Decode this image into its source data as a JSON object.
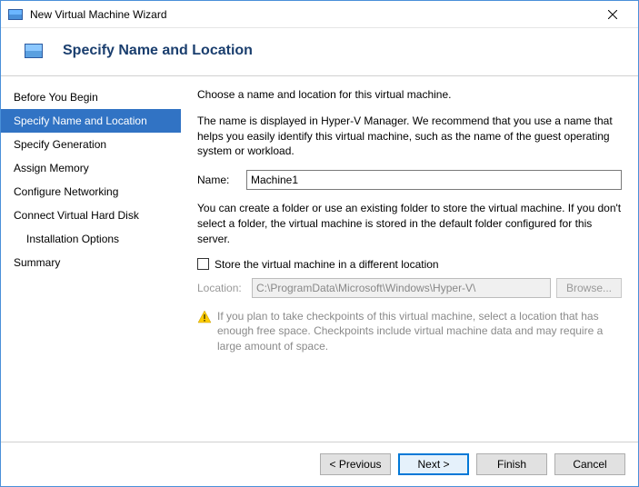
{
  "titlebar": {
    "title": "New Virtual Machine Wizard"
  },
  "header": {
    "title": "Specify Name and Location"
  },
  "sidebar": {
    "items": [
      {
        "label": "Before You Begin"
      },
      {
        "label": "Specify Name and Location"
      },
      {
        "label": "Specify Generation"
      },
      {
        "label": "Assign Memory"
      },
      {
        "label": "Configure Networking"
      },
      {
        "label": "Connect Virtual Hard Disk"
      },
      {
        "label": "Installation Options"
      },
      {
        "label": "Summary"
      }
    ]
  },
  "content": {
    "intro": "Choose a name and location for this virtual machine.",
    "name_help": "The name is displayed in Hyper-V Manager. We recommend that you use a name that helps you easily identify this virtual machine, such as the name of the guest operating system or workload.",
    "name_label": "Name:",
    "name_value": "Machine1",
    "folder_help": "You can create a folder or use an existing folder to store the virtual machine. If you don't select a folder, the virtual machine is stored in the default folder configured for this server.",
    "store_checkbox": "Store the virtual machine in a different location",
    "location_label": "Location:",
    "location_value": "C:\\ProgramData\\Microsoft\\Windows\\Hyper-V\\",
    "browse_label": "Browse...",
    "warning": "If you plan to take checkpoints of this virtual machine, select a location that has enough free space. Checkpoints include virtual machine data and may require a large amount of space."
  },
  "footer": {
    "previous": "< Previous",
    "next": "Next >",
    "finish": "Finish",
    "cancel": "Cancel"
  }
}
